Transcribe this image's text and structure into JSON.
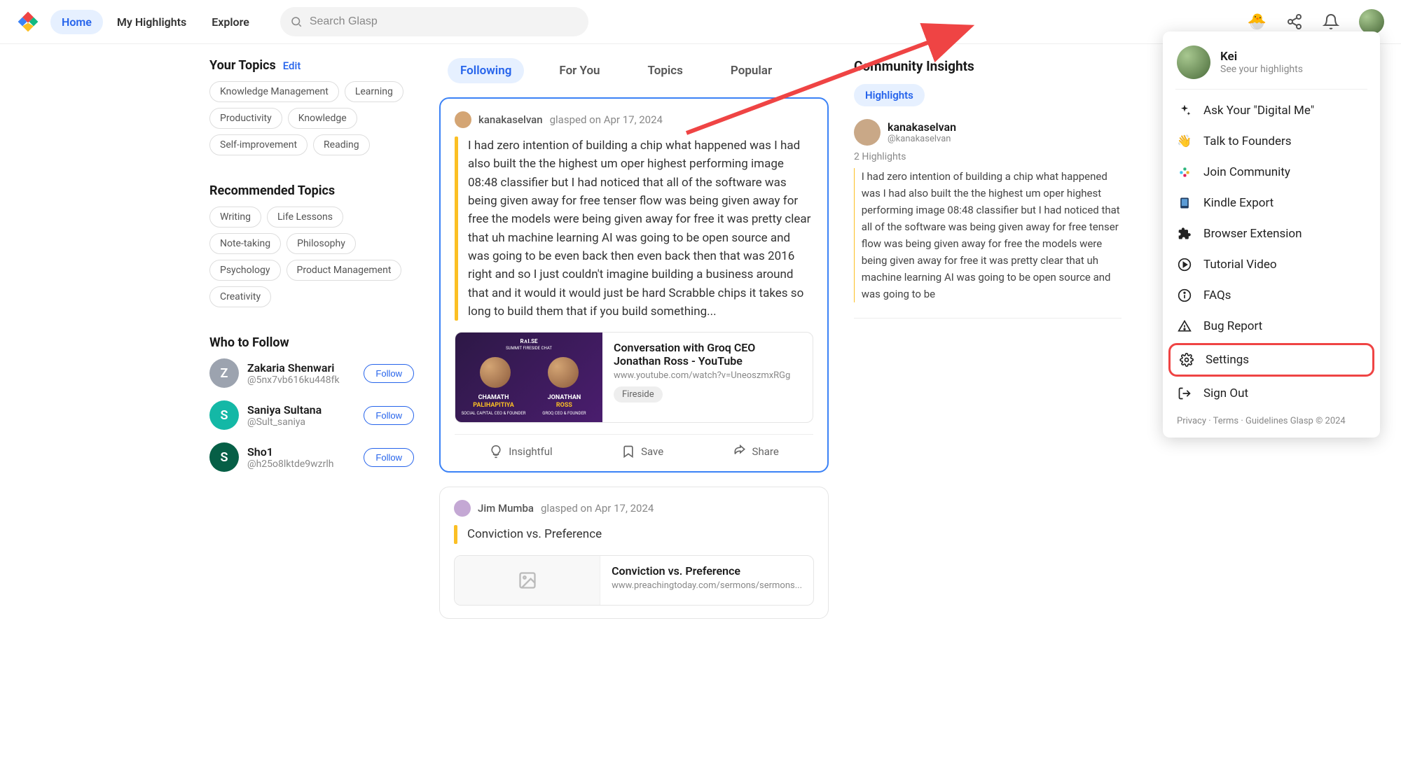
{
  "nav": {
    "home": "Home",
    "myHighlights": "My Highlights",
    "explore": "Explore",
    "searchPlaceholder": "Search Glasp"
  },
  "sidebar": {
    "yourTopics": {
      "title": "Your Topics",
      "edit": "Edit",
      "items": [
        "Knowledge Management",
        "Learning",
        "Productivity",
        "Knowledge",
        "Self-improvement",
        "Reading"
      ]
    },
    "recTopics": {
      "title": "Recommended Topics",
      "items": [
        "Writing",
        "Life Lessons",
        "Note-taking",
        "Philosophy",
        "Psychology",
        "Product Management",
        "Creativity"
      ]
    },
    "whoToFollow": {
      "title": "Who to Follow",
      "followBtn": "Follow",
      "items": [
        {
          "initial": "Z",
          "name": "Zakaria Shenwari",
          "handle": "@5nx7vb616ku448fk",
          "color": "#9ca3af"
        },
        {
          "initial": "S",
          "name": "Saniya Sultana",
          "handle": "@Sult_saniya",
          "color": "#14b8a6"
        },
        {
          "initial": "S",
          "name": "Sho1",
          "handle": "@h25o8lktde9wzrlh",
          "color": "#065f46"
        }
      ]
    }
  },
  "feed": {
    "tabs": [
      "Following",
      "For You",
      "Topics",
      "Popular"
    ],
    "cards": [
      {
        "user": "kanakaselvan",
        "meta": "glasped on Apr 17, 2024",
        "highlight": "I had zero intention of building a chip what happened was I had also built the the highest um oper highest performing image 08:48 classifier but I had noticed that all of the software was being given away for free tenser flow was being given away for free the models were being given away for free it was pretty clear that uh machine learning AI was going to be open source and was going to be even back then even back then that was 2016 right and so I just couldn't imagine building a business around that and it would it would just be hard Scrabble chips it takes so long to build them that if you build something...",
        "link": {
          "title": "Conversation with Groq CEO Jonathan Ross - YouTube",
          "url": "www.youtube.com/watch?v=UneoszmxRGg",
          "tag": "Fireside"
        },
        "thumbNames": {
          "l1": "CHAMATH",
          "l2": "PALIHAPITIYA",
          "l3": "SOCIAL CAPITAL\nCEO & FOUNDER",
          "r1": "JONATHAN",
          "r2": "ROSS",
          "r3": "GROQ\nCEO & FOUNDER",
          "top": "R∧I.SE",
          "sub": "SUMMIT FIRESIDE CHAT"
        },
        "actions": {
          "a": "Insightful",
          "b": "Save",
          "c": "Share"
        }
      },
      {
        "user": "Jim Mumba",
        "meta": "glasped on Apr 17, 2024",
        "highlight": "Conviction vs. Preference",
        "link": {
          "title": "Conviction vs. Preference",
          "url": "www.preachingtoday.com/sermons/sermons..."
        }
      }
    ]
  },
  "community": {
    "title": "Community Insights",
    "tab": "Highlights",
    "user": {
      "name": "kanakaselvan",
      "handle": "@kanakaselvan"
    },
    "count": "2 Highlights",
    "text": "I had zero intention of building a chip what happened was I had also built the the highest um oper highest performing image 08:48 classifier but I had noticed that all of the software was being given away for free tenser flow was being given away for free the models were being given away for free it was pretty clear that uh machine learning AI was going to be open source and was going to be"
  },
  "dropdown": {
    "name": "Kei",
    "sub": "See your highlights",
    "items": [
      {
        "icon": "sparkle",
        "label": "Ask Your \"Digital Me\""
      },
      {
        "icon": "wave",
        "label": "Talk to Founders"
      },
      {
        "icon": "slack",
        "label": "Join Community"
      },
      {
        "icon": "kindle",
        "label": "Kindle Export"
      },
      {
        "icon": "puzzle",
        "label": "Browser Extension"
      },
      {
        "icon": "play",
        "label": "Tutorial Video"
      },
      {
        "icon": "info",
        "label": "FAQs"
      },
      {
        "icon": "warn",
        "label": "Bug Report"
      },
      {
        "icon": "gear",
        "label": "Settings",
        "highlighted": true
      },
      {
        "icon": "signout",
        "label": "Sign Out"
      }
    ],
    "footer": {
      "privacy": "Privacy",
      "terms": "Terms",
      "guidelines": "Guidelines",
      "brand": "Glasp © 2024"
    }
  }
}
